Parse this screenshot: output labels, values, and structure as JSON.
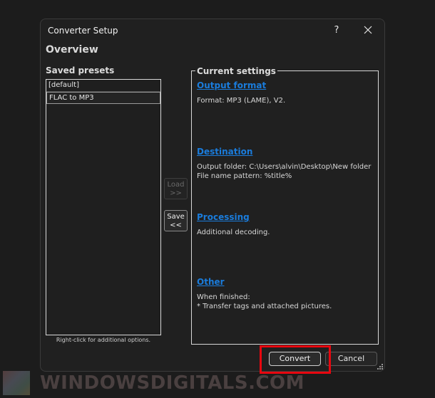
{
  "dialog": {
    "title": "Converter Setup",
    "help_label": "?",
    "heading": "Overview"
  },
  "presets": {
    "label": "Saved presets",
    "items": [
      {
        "label": "[default]",
        "selected": false
      },
      {
        "label": "FLAC to MP3",
        "selected": true
      }
    ],
    "hint": "Right-click for additional options."
  },
  "buttons": {
    "load_line1": "Load",
    "load_line2": ">>",
    "save_line1": "Save",
    "save_line2": "<<",
    "convert": "Convert",
    "cancel": "Cancel"
  },
  "settings": {
    "legend": "Current settings",
    "sections": [
      {
        "title": "Output format",
        "text": "Format: MP3 (LAME), V2."
      },
      {
        "title": "Destination",
        "text": "Output folder: C:\\Users\\alvin\\Desktop\\New folder\nFile name pattern: %title%"
      },
      {
        "title": "Processing",
        "text": "Additional decoding."
      },
      {
        "title": "Other",
        "text": "When finished:\n* Transfer tags and attached pictures."
      }
    ]
  },
  "watermark": {
    "text": "WindowsDigitals.com"
  },
  "colors": {
    "link": "#1a7cdc",
    "highlight": "#e8070f",
    "background": "#202020"
  }
}
